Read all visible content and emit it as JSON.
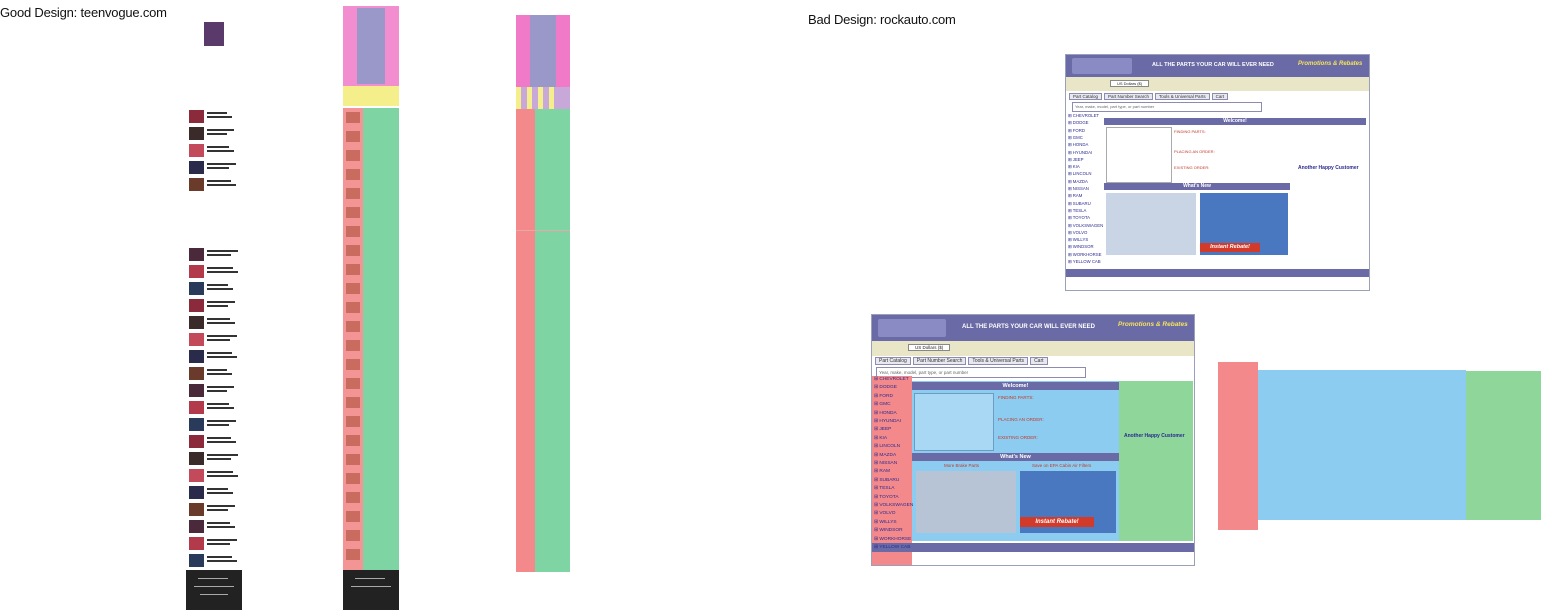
{
  "headings": {
    "good": "Good Design: teenvogue.com",
    "bad": "Bad Design: rockauto.com"
  },
  "rockauto": {
    "tagline": "ALL THE PARTS YOUR CAR WILL EVER NEED",
    "rebates": "Promotions & Rebates",
    "currency": "US Dollars ($)",
    "tabs": [
      "Part Catalog",
      "Part Number Search",
      "Tools & Universal Parts",
      "Cart"
    ],
    "search_placeholder": "Year, make, model, part type, or part number",
    "welcome": "Welcome!",
    "whats_new": "What's New",
    "another_happy": "Another Happy Customer",
    "more_brake": "More Brake Parts",
    "cabin_filters": "Save on EPA Cabin Air Filters",
    "instant_rebate": "Instant Rebate!",
    "makes": [
      "CHEVROLET",
      "DODGE",
      "FORD",
      "GMC",
      "HONDA",
      "HYUNDAI",
      "JEEP",
      "KIA",
      "LINCOLN",
      "MAZDA",
      "NISSAN",
      "RAM",
      "SUBARU",
      "TESLA",
      "TOYOTA",
      "VOLKSWAGEN",
      "VOLVO",
      "WILLYS",
      "WINDSOR",
      "WORKHORSE",
      "YELLOW CAB"
    ],
    "finding_parts": "FINDING PARTS:",
    "placing_order": "PLACING AN ORDER:",
    "existing_order": "EXISTING ORDER:"
  },
  "colors": {
    "magenta": "#f07ac8",
    "lavender": "#9a98c8",
    "yellow": "#f4ef8a",
    "salmon": "#f3898a",
    "green": "#7fd4a4",
    "light_green": "#8ed69a",
    "sky": "#8cccf0",
    "ra_purple": "#6a6aa6"
  }
}
